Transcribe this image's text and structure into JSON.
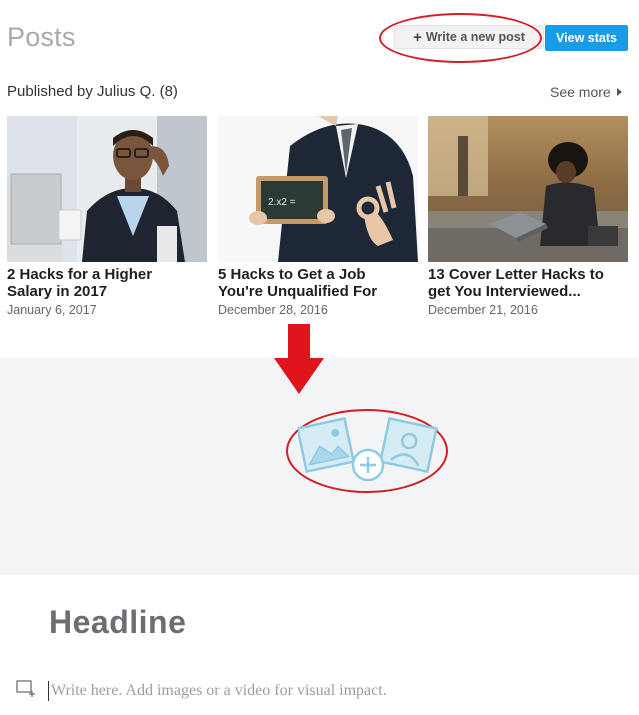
{
  "header": {
    "title": "Posts",
    "write_button": "Write a new post",
    "stats_button": "View stats"
  },
  "published": {
    "label": "Published by Julius Q. (8)",
    "see_more": "See more"
  },
  "posts": [
    {
      "title_line1": "2 Hacks for a Higher",
      "title_line2": "Salary in 2017",
      "date": "January 6, 2017"
    },
    {
      "title_line1": "5 Hacks to Get a Job",
      "title_line2": "You're Unqualified For",
      "date": "December 28, 2016"
    },
    {
      "title_line1": "13 Cover Letter Hacks to",
      "title_line2": "get You Interviewed...",
      "date": "December 21, 2016"
    }
  ],
  "chalkboard_text": "2.x2 =",
  "editor": {
    "headline": "Headline",
    "body_placeholder": "Write here. Add images or a video for visual impact."
  },
  "colors": {
    "accent_blue": "#1a9be6",
    "annotation_red": "#d21f26",
    "icon_blue": "#8ecbe3"
  }
}
